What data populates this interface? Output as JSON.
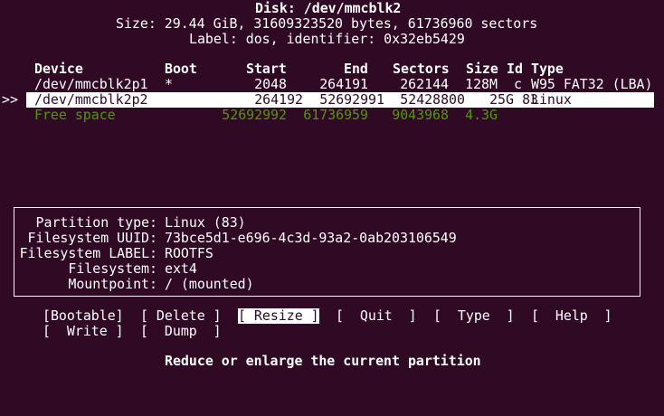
{
  "colors": {
    "background": "#300a24",
    "foreground": "#ffffff",
    "free_space": "#4e9a06"
  },
  "header": {
    "disk": "Disk: /dev/mmcblk2",
    "size": "Size: 29.44 GiB, 31609323520 bytes, 61736960 sectors",
    "label": "Label: dos, identifier: 0x32eb5429"
  },
  "table": {
    "headers": [
      "Device",
      "Boot",
      "Start",
      "End",
      "Sectors",
      "Size",
      "Id",
      "Type"
    ],
    "cursor": ">>",
    "rows": [
      {
        "device": "/dev/mmcblk2p1",
        "boot": "*",
        "start": "2048",
        "end": "264191",
        "sectors": "262144",
        "size": "128M",
        "id": "c",
        "type": "W95 FAT32 (LBA)"
      },
      {
        "device": "/dev/mmcblk2p2",
        "boot": "",
        "start": "264192",
        "end": "52692991",
        "sectors": "52428800",
        "size": "25G",
        "id": "83",
        "type": "Linux"
      },
      {
        "device": "Free space",
        "boot": "",
        "start": "52692992",
        "end": "61736959",
        "sectors": "9043968",
        "size": "4.3G",
        "id": "",
        "type": ""
      }
    ]
  },
  "info": {
    "partition_type_label": "Partition type:",
    "partition_type_value": "Linux (83)",
    "fs_uuid_label": "Filesystem UUID:",
    "fs_uuid_value": "73bce5d1-e696-4c3d-93a2-0ab203106549",
    "fs_label_label": "Filesystem LABEL:",
    "fs_label_value": "ROOTFS",
    "filesystem_label": "Filesystem:",
    "filesystem_value": "ext4",
    "mountpoint_label": "Mountpoint:",
    "mountpoint_value": "/ (mounted)"
  },
  "menu": {
    "bootable": "[Bootable]",
    "delete": "[ Delete ]",
    "resize": "[ Resize ]",
    "quit": "[  Quit  ]",
    "type": "[  Type  ]",
    "help": "[  Help  ]",
    "write": "[  Write ]",
    "dump": "[  Dump  ]",
    "selected": "resize"
  },
  "status": "Reduce or enlarge the current partition"
}
